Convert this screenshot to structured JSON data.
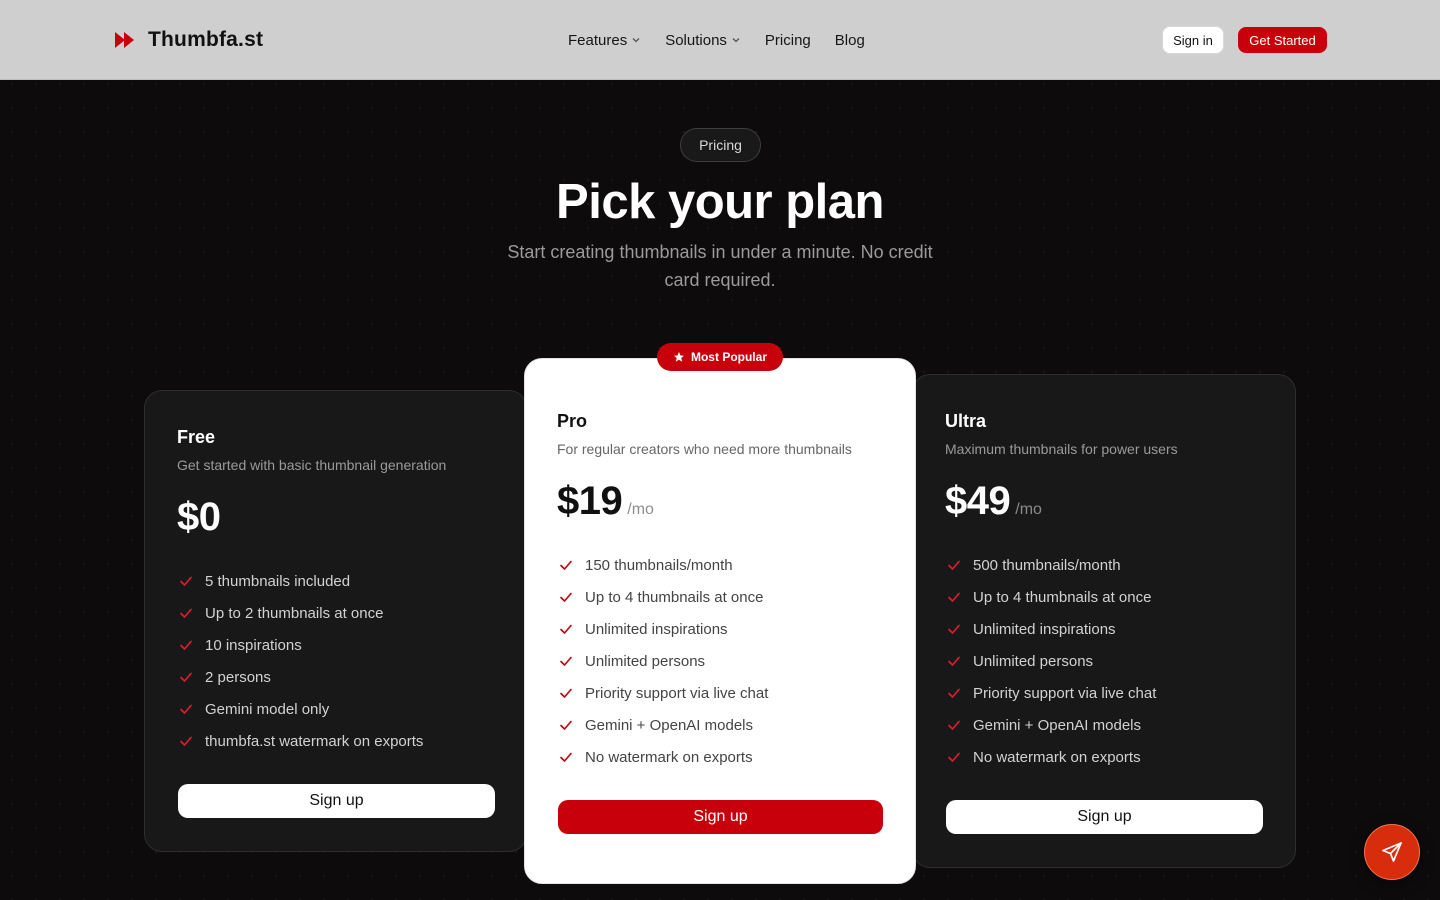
{
  "brand": {
    "name": "Thumbfa.st",
    "logo_icon": "fast-forward-icon",
    "accent_color": "#c8000b"
  },
  "nav": {
    "features_label": "Features",
    "solutions_label": "Solutions",
    "pricing_label": "Pricing",
    "blog_label": "Blog"
  },
  "header_actions": {
    "signin_label": "Sign in",
    "get_started_label": "Get Started"
  },
  "hero": {
    "pill_label": "Pricing",
    "title": "Pick your plan",
    "subtitle": "Start creating thumbnails in under a minute. No credit card required."
  },
  "plans": {
    "free": {
      "name": "Free",
      "description": "Get started with basic thumbnail generation",
      "price": "$0",
      "unit": "",
      "features": [
        "5 thumbnails included",
        "Up to 2 thumbnails at once",
        "10 inspirations",
        "2 persons",
        "Gemini model only",
        "thumbfa.st watermark on exports"
      ],
      "cta": "Sign up"
    },
    "pro": {
      "badge": "Most Popular",
      "name": "Pro",
      "description": "For regular creators who need more thumbnails",
      "price": "$19",
      "unit": "/mo",
      "features": [
        "150 thumbnails/month",
        "Up to 4 thumbnails at once",
        "Unlimited inspirations",
        "Unlimited persons",
        "Priority support via live chat",
        "Gemini + OpenAI models",
        "No watermark on exports"
      ],
      "cta": "Sign up"
    },
    "ultra": {
      "name": "Ultra",
      "description": "Maximum thumbnails for power users",
      "price": "$49",
      "unit": "/mo",
      "features": [
        "500 thumbnails/month",
        "Up to 4 thumbnails at once",
        "Unlimited inspirations",
        "Unlimited persons",
        "Priority support via live chat",
        "Gemini + OpenAI models",
        "No watermark on exports"
      ],
      "cta": "Sign up"
    }
  },
  "fab": {
    "icon": "send-icon"
  }
}
